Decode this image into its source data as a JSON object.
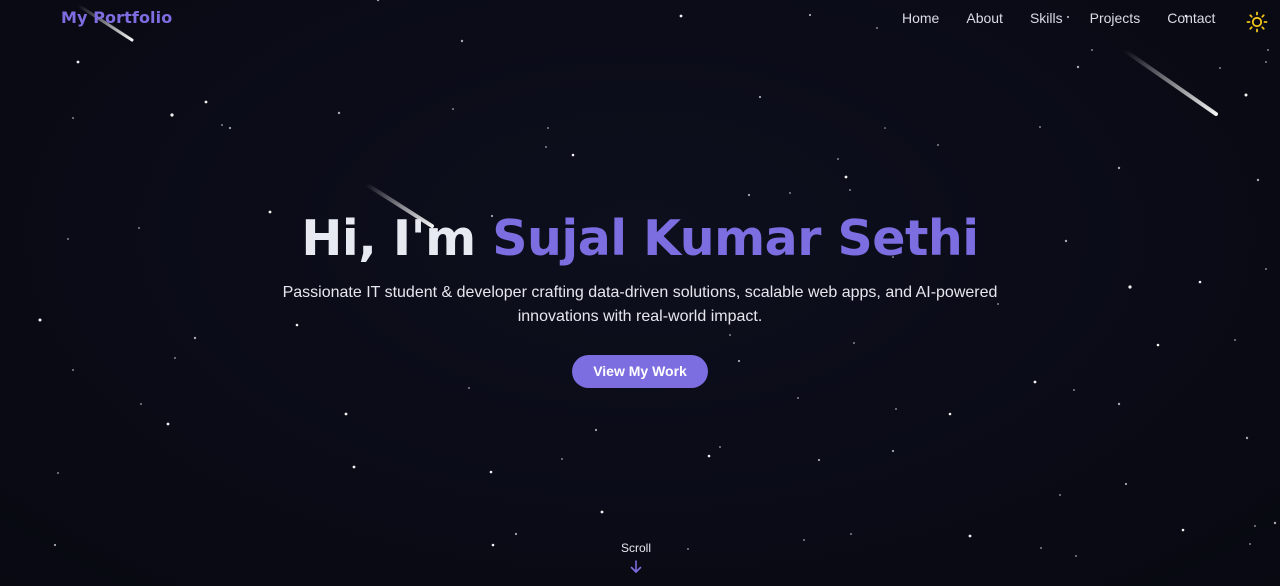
{
  "nav": {
    "brand": "My Portfolio",
    "links": [
      "Home",
      "About",
      "Skills",
      "Projects",
      "Contact"
    ],
    "theme_icon": "sun-icon"
  },
  "hero": {
    "greeting": "Hi, I'm ",
    "name": "Sujal Kumar Sethi",
    "subtitle": "Passionate IT student & developer crafting data-driven solutions, scalable web apps, and AI-powered innovations with real-world impact.",
    "cta_label": "View My Work"
  },
  "scroll": {
    "label": "Scroll",
    "icon": "arrow-down-icon"
  },
  "colors": {
    "background": "#0b0c18",
    "accent": "#7c6ee0",
    "text": "#e8eaf2",
    "sun": "#f5c518"
  }
}
